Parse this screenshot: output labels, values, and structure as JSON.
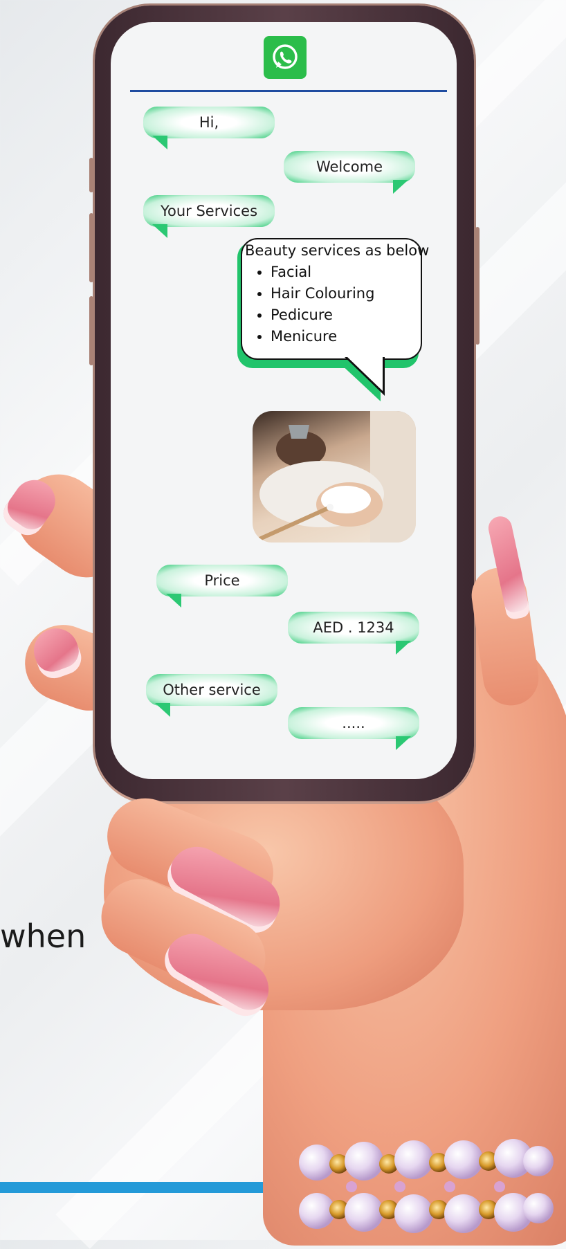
{
  "app": {
    "name": "WhatsApp"
  },
  "chat": {
    "messages": [
      {
        "side": "left",
        "text": "Hi,"
      },
      {
        "side": "right",
        "text": "Welcome"
      },
      {
        "side": "left",
        "text": "Your Services"
      },
      {
        "side": "left",
        "text": "Price"
      },
      {
        "side": "right",
        "text": "AED . 1234"
      },
      {
        "side": "left",
        "text": "Other service"
      },
      {
        "side": "right",
        "text": "....."
      }
    ],
    "services_card": {
      "title": "Beauty services as below",
      "items": [
        "Facial",
        "Hair Colouring",
        "Pedicure",
        "Menicure"
      ]
    }
  },
  "background": {
    "partial_text": "when"
  },
  "colors": {
    "whatsapp_green": "#2bbd4a",
    "bubble_green": "#2bc873",
    "header_line": "#1f4ca0",
    "bottom_bar": "#249ad8"
  },
  "icons": {
    "logo": "whatsapp-icon"
  }
}
